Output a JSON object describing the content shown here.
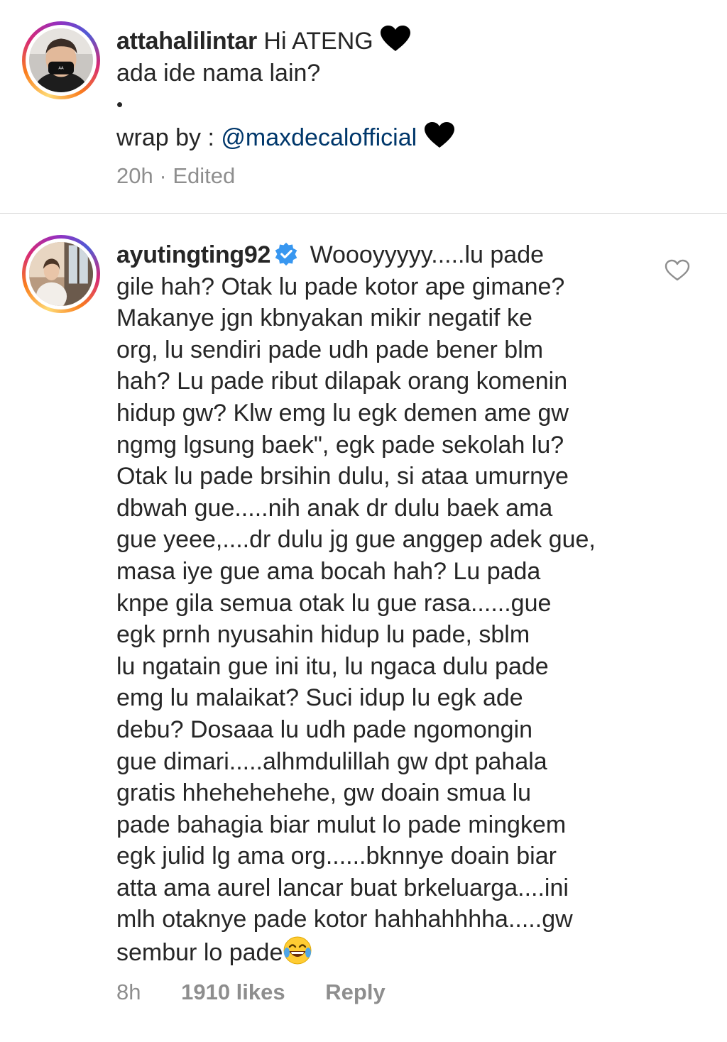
{
  "caption": {
    "username": "attahalilintar",
    "line1_text": "Hi ATENG",
    "line2_text": "ada ide nama lain?",
    "bullet": "•",
    "wrap_prefix": "wrap by : ",
    "mention": "@maxdecalofficial",
    "time": "20h",
    "separator": "·",
    "edited": "Edited"
  },
  "comment": {
    "username": "ayutingting92",
    "lines": [
      "Woooyyyyy.....lu pade",
      "gile hah? Otak lu pade kotor ape gimane?",
      "Makanye jgn kbnyakan mikir negatif ke",
      "org, lu sendiri pade udh pade bener blm",
      "hah? Lu pade ribut dilapak orang komenin",
      "hidup gw? Klw emg lu egk demen ame gw",
      "ngmg lgsung baek\", egk pade sekolah lu?",
      "Otak lu pade brsihin dulu, si ataa umurnye",
      "dbwah gue.....nih anak dr dulu baek ama",
      "gue yeee,....dr dulu jg gue anggep adek gue,",
      "masa iye gue ama bocah hah? Lu pada",
      "knpe gila semua otak lu gue rasa......gue",
      "egk prnh nyusahin hidup lu pade, sblm",
      "lu ngatain gue ini itu, lu ngaca dulu pade",
      "emg lu malaikat? Suci idup lu egk ade",
      "debu? Dosaaa lu udh pade ngomongin",
      "gue dimari.....alhmdulillah gw dpt pahala",
      "gratis hhehehehehe, gw doain smua lu",
      "pade bahagia biar mulut lo pade mingkem",
      "egk julid lg ama org......bknnye doain biar",
      "atta ama aurel lancar buat brkeluarga....ini",
      "mlh otaknye pade kotor hahhahhhha.....gw",
      "sembur lo pade"
    ],
    "time": "8h",
    "likes": "1910 likes",
    "reply": "Reply"
  },
  "icons": {
    "heart_emoji": "black-heart-emoji",
    "verified": "verified-badge-icon",
    "like": "heart-outline-icon",
    "laugh": "tears-of-joy-emoji"
  },
  "colors": {
    "text": "#262626",
    "meta": "#8e8e8e",
    "mention": "#00376b",
    "verified": "#3897f0",
    "divider": "#dbdbdb"
  }
}
